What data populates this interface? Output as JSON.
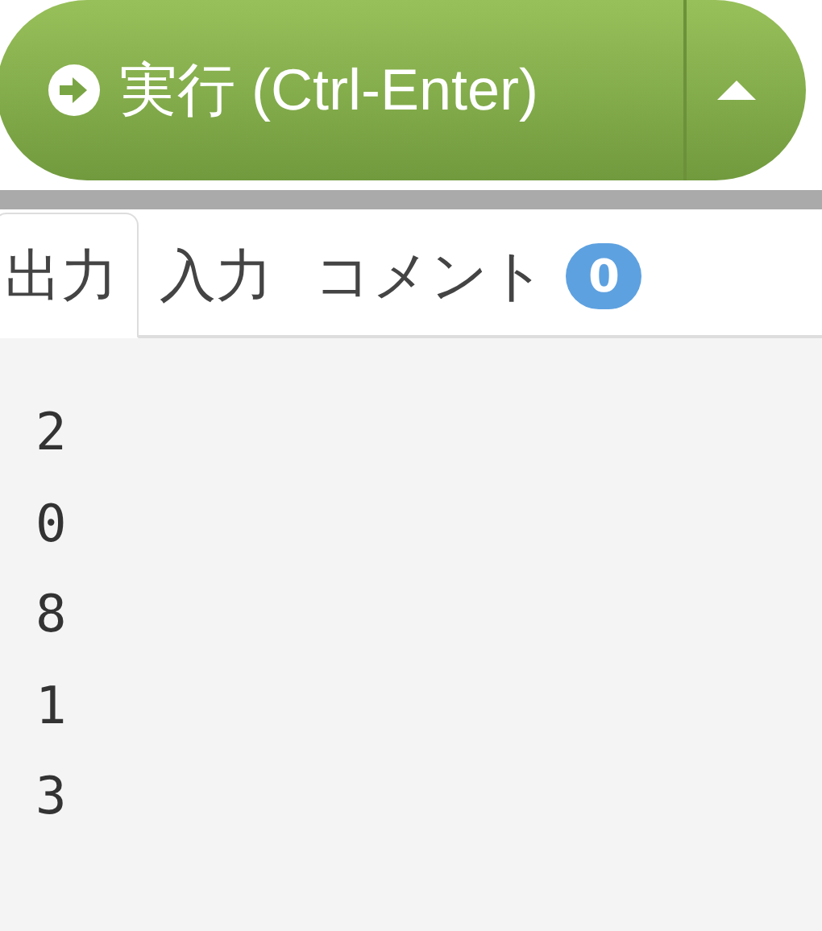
{
  "run_button": {
    "label": "実行 (Ctrl-Enter)"
  },
  "tabs": [
    {
      "label": "出力",
      "selected": true
    },
    {
      "label": "入力",
      "selected": false
    },
    {
      "label": "コメント",
      "selected": false,
      "badge": "0"
    }
  ],
  "output_lines": [
    "2",
    "0",
    "8",
    "1",
    "3"
  ]
}
